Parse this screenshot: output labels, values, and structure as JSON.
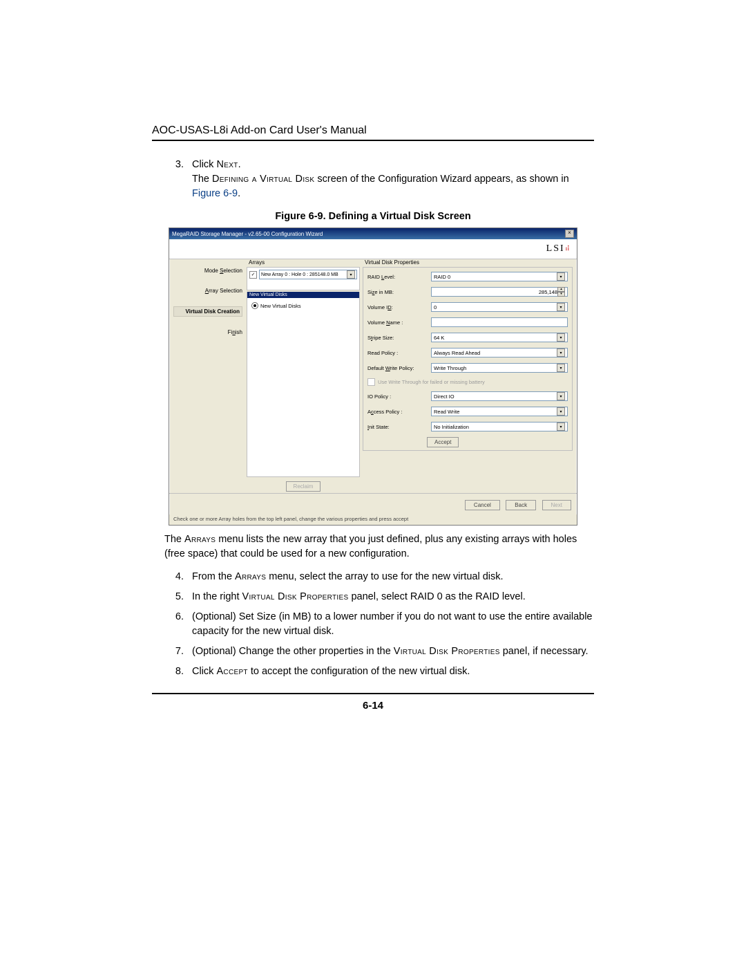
{
  "doc": {
    "header": "AOC-USAS-L8i Add-on Card User's Manual",
    "page_number": "6-14",
    "figure_caption": "Figure 6-9. Defining a Virtual Disk Screen",
    "figure_ref": "Figure 6-9"
  },
  "steps_top": {
    "s3_num": "3.",
    "s3_line1a": "Click ",
    "s3_line1b_sc": "Next",
    "s3_line1c": ".",
    "s3_line2a": "The ",
    "s3_line2b_sc": "Defining a Virtual Disk",
    "s3_line2c": " screen of the Configuration Wizard appears, as shown in "
  },
  "para_after": {
    "a": "The ",
    "b_sc": "Arrays",
    "c": " menu lists the new array that you just defined, plus any existing arrays with holes (free space) that could be used for a new configuration."
  },
  "steps_bottom": {
    "s4_num": "4.",
    "s4a": "From the ",
    "s4b_sc": "Arrays",
    "s4c": " menu, select the array to use for the new virtual disk.",
    "s5_num": "5.",
    "s5a": "In the right ",
    "s5b_sc": "Virtual Disk Properties",
    "s5c": " panel, select RAID 0 as the RAID level.",
    "s6_num": "6.",
    "s6": "(Optional) Set Size (in MB) to a lower number if you do not want to use the entire available capacity for the new virtual disk.",
    "s7_num": "7.",
    "s7a": "(Optional) Change the other properties in the ",
    "s7b_sc": "Virtual Disk Properties",
    "s7c": " panel, if necessary.",
    "s8_num": "8.",
    "s8a": "Click ",
    "s8b_sc": "Accept",
    "s8c": " to accept the configuration of the new virtual disk."
  },
  "wizard": {
    "title": "MegaRAID Storage Manager - v2.65-00 Configuration Wizard",
    "logo": "LSI",
    "close": "×",
    "sidebar": {
      "mode_selection": "Mode Selection",
      "array_selection": "Array Selection",
      "vdc": "Virtual Disk Creation",
      "finish": "Finish"
    },
    "arrays": {
      "legend": "Arrays",
      "checked": "✓",
      "item": "New Array 0 : Hole 0 : 285148.0 MB",
      "dd_arrow": "▾"
    },
    "nvd": {
      "head": "New Virtual Disks",
      "item": "New Virtual Disks"
    },
    "reclaim": "Reclaim",
    "props": {
      "legend": "Virtual Disk Properties",
      "raid_label": "RAID Level:",
      "raid_value": "RAID 0",
      "size_label": "Size in MB:",
      "size_value": "285,148",
      "vol_id_label": "Volume ID:",
      "vol_id_value": "0",
      "vol_name_label": "Volume Name :",
      "vol_name_value": "",
      "stripe_label": "Stripe Size:",
      "stripe_value": "64 K",
      "read_label": "Read Policy :",
      "read_value": "Always Read Ahead",
      "write_label": "Default Write Policy:",
      "write_value": "Write Through",
      "wt_check": "Use Write Through for failed or missing battery",
      "io_label": "IO Policy :",
      "io_value": "Direct IO",
      "access_label": "Access Policy :",
      "access_value": "Read Write",
      "init_label": "Init State:",
      "init_value": "No Initialization",
      "accept": "Accept",
      "dd_arrow": "▾",
      "spin_up": "▴",
      "spin_dn": "▾"
    },
    "footer": {
      "cancel": "Cancel",
      "back": "Back",
      "next": "Next"
    },
    "hint": "Check one or more Array holes from the top left panel, change the various properties and press accept"
  }
}
